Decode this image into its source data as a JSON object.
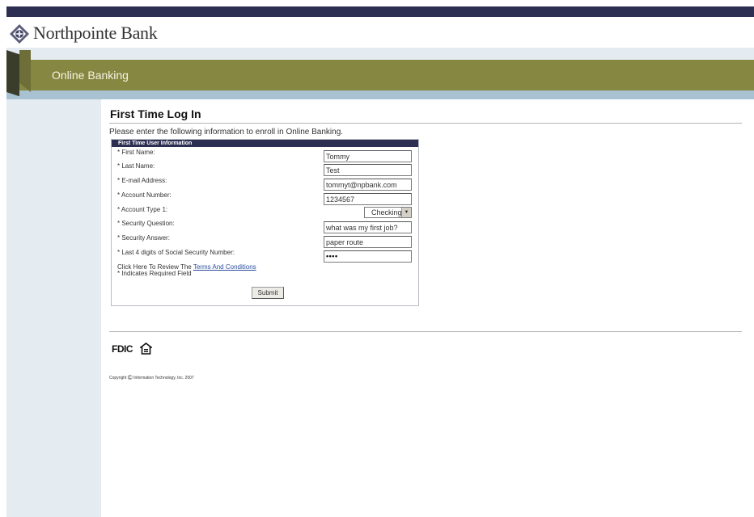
{
  "brand": {
    "name": "Northpointe Bank",
    "logo_icon": "compass-diamond-icon"
  },
  "nav": {
    "title": "Online Banking"
  },
  "page": {
    "title": "First Time Log In",
    "intro": "Please enter the following information to enroll in Online Banking."
  },
  "form": {
    "header": "First Time User Information",
    "fields": [
      {
        "label": "* First Name:",
        "value": "Tommy"
      },
      {
        "label": "* Last Name:",
        "value": "Test"
      },
      {
        "label": "* E-mail Address:",
        "value": "tommyt@npbank.com"
      },
      {
        "label": "* Account Number:",
        "value": "1234567"
      },
      {
        "label": "* Account Type 1:",
        "value": "Checking"
      },
      {
        "label": "* Security Question:",
        "value": "what was my first job?"
      },
      {
        "label": "* Security Answer:",
        "value": "paper route"
      },
      {
        "label": "* Last 4 digits of Social Security Number:",
        "value": "••••"
      }
    ],
    "terms_prefix": "Click Here To Review The",
    "terms_link": "Terms And Conditions",
    "required_note": "* Indicates Required Field",
    "submit_label": "Submit"
  },
  "footer": {
    "fdic_label": "FDIC",
    "equal_housing_icon": "equal-housing-lender-icon",
    "copyright_prefix": "Copyright",
    "copyright_symbol": "©",
    "copyright_text": "Information Technology, Inc. 2007"
  },
  "colors": {
    "top_bar": "#2d2f52",
    "nav_band": "#868740",
    "under_band": "#a9c2d2",
    "sidebar": "#e4ecf2",
    "link": "#2a4d9c"
  }
}
